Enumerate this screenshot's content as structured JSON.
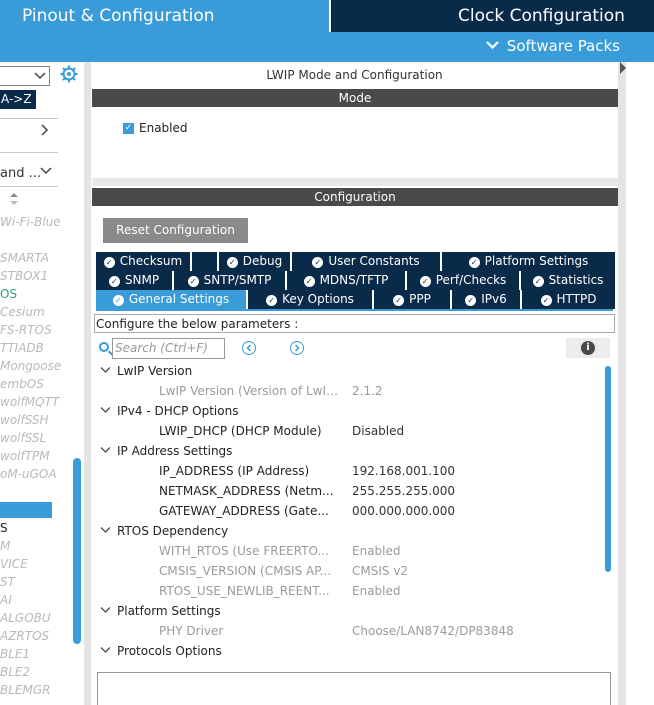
{
  "header": {
    "tab_pinout": "Pinout & Configuration",
    "tab_clock": "Clock Configuration",
    "software_packs": "Software Packs"
  },
  "sidebar": {
    "sort_label": "A->Z",
    "and_label": "and ...",
    "items": [
      {
        "text": "Wi-Fi-Blue",
        "style": "muted"
      },
      {
        "text": "SMARTA",
        "style": "muted"
      },
      {
        "text": "STBOX1",
        "style": "muted"
      },
      {
        "text": "OS",
        "style": "green"
      },
      {
        "text": "Cesium",
        "style": "muted"
      },
      {
        "text": "FS-RTOS",
        "style": "muted"
      },
      {
        "text": "TTIADB",
        "style": "muted"
      },
      {
        "text": "Mongoose",
        "style": "muted"
      },
      {
        "text": "embOS",
        "style": "muted"
      },
      {
        "text": "wolfMQTT",
        "style": "muted"
      },
      {
        "text": "wolfSSH",
        "style": "muted"
      },
      {
        "text": "wolfSSL",
        "style": "muted"
      },
      {
        "text": "wolfTPM",
        "style": "muted"
      },
      {
        "text": "oM-uGOA",
        "style": "muted"
      },
      {
        "text": "S",
        "style": "dark"
      },
      {
        "text": "M",
        "style": "muted"
      },
      {
        "text": "VICE",
        "style": "muted"
      },
      {
        "text": "ST",
        "style": "muted"
      },
      {
        "text": "AI",
        "style": "muted"
      },
      {
        "text": "ALGOBU",
        "style": "muted"
      },
      {
        "text": "AZRTOS",
        "style": "muted"
      },
      {
        "text": "BLE1",
        "style": "muted"
      },
      {
        "text": "BLE2",
        "style": "muted"
      },
      {
        "text": "BLEMGR",
        "style": "muted"
      }
    ]
  },
  "main": {
    "title": "LWIP Mode and Configuration",
    "mode_bar": "Mode",
    "enabled_label": "Enabled",
    "config_bar": "Configuration",
    "reset_button": "Reset Configuration",
    "tabs_row1": [
      "Checksum",
      "Debug",
      "User Constants",
      "Platform Settings"
    ],
    "tabs_row2": [
      "SNMP",
      "SNTP/SMTP",
      "MDNS/TFTP",
      "Perf/Checks",
      "Statistics"
    ],
    "tabs_row3": [
      "General Settings",
      "Key Options",
      "PPP",
      "IPv6",
      "HTTPD"
    ],
    "active_tab": "General Settings",
    "description": "Configure the below parameters :",
    "search_placeholder": "Search (Ctrl+F)",
    "tree": [
      {
        "type": "group",
        "label": "LwIP Version"
      },
      {
        "type": "param",
        "label": "LwIP Version (Version of LwIP ...",
        "value": "2.1.2",
        "dim": true
      },
      {
        "type": "group",
        "label": "IPv4 - DHCP Options"
      },
      {
        "type": "param",
        "label": "LWIP_DHCP (DHCP Module)",
        "value": "Disabled",
        "dim": false
      },
      {
        "type": "group",
        "label": "IP Address Settings"
      },
      {
        "type": "param",
        "label": "IP_ADDRESS (IP Address)",
        "value": "192.168.001.100",
        "dim": false
      },
      {
        "type": "param",
        "label": "NETMASK_ADDRESS (Netm...",
        "value": "255.255.255.000",
        "dim": false
      },
      {
        "type": "param",
        "label": "GATEWAY_ADDRESS (Gate...",
        "value": "000.000.000.000",
        "dim": false
      },
      {
        "type": "group",
        "label": "RTOS Dependency"
      },
      {
        "type": "param",
        "label": "WITH_RTOS (Use FREERTO...",
        "value": "Enabled",
        "dim": true
      },
      {
        "type": "param",
        "label": "CMSIS_VERSION (CMSIS AP...",
        "value": "CMSIS v2",
        "dim": true
      },
      {
        "type": "param",
        "label": "RTOS_USE_NEWLIB_REENT...",
        "value": "Enabled",
        "dim": true
      },
      {
        "type": "group",
        "label": "Platform Settings"
      },
      {
        "type": "param",
        "label": "PHY Driver",
        "value": "Choose/LAN8742/DP83848",
        "dim": true
      },
      {
        "type": "group",
        "label": "Protocols Options"
      }
    ]
  },
  "colors": {
    "accent": "#3a9bd9",
    "navy": "#0a2a4a",
    "bar_dark": "#4a4a4a"
  }
}
